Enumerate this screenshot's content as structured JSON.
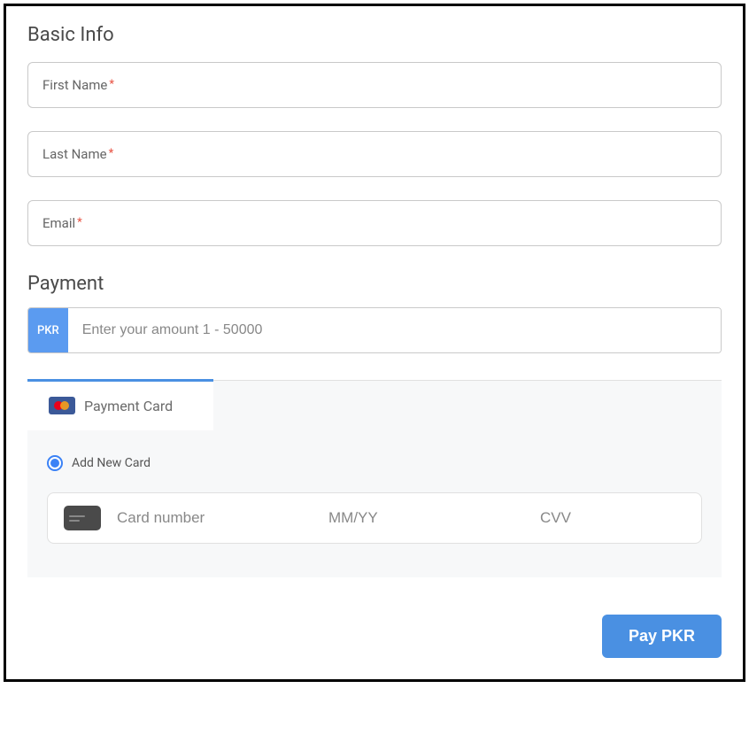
{
  "basic_info": {
    "title": "Basic Info",
    "first_name_label": "First Name",
    "last_name_label": "Last Name",
    "email_label": "Email",
    "required_mark": "*"
  },
  "payment": {
    "title": "Payment",
    "currency_code": "PKR",
    "amount_placeholder": "Enter your amount 1 - 50000",
    "tab_label": "Payment Card",
    "add_new_card_label": "Add New Card",
    "card_number_placeholder": "Card number",
    "expiry_placeholder": "MM/YY",
    "cvv_placeholder": "CVV",
    "pay_button_label": "Pay PKR"
  }
}
